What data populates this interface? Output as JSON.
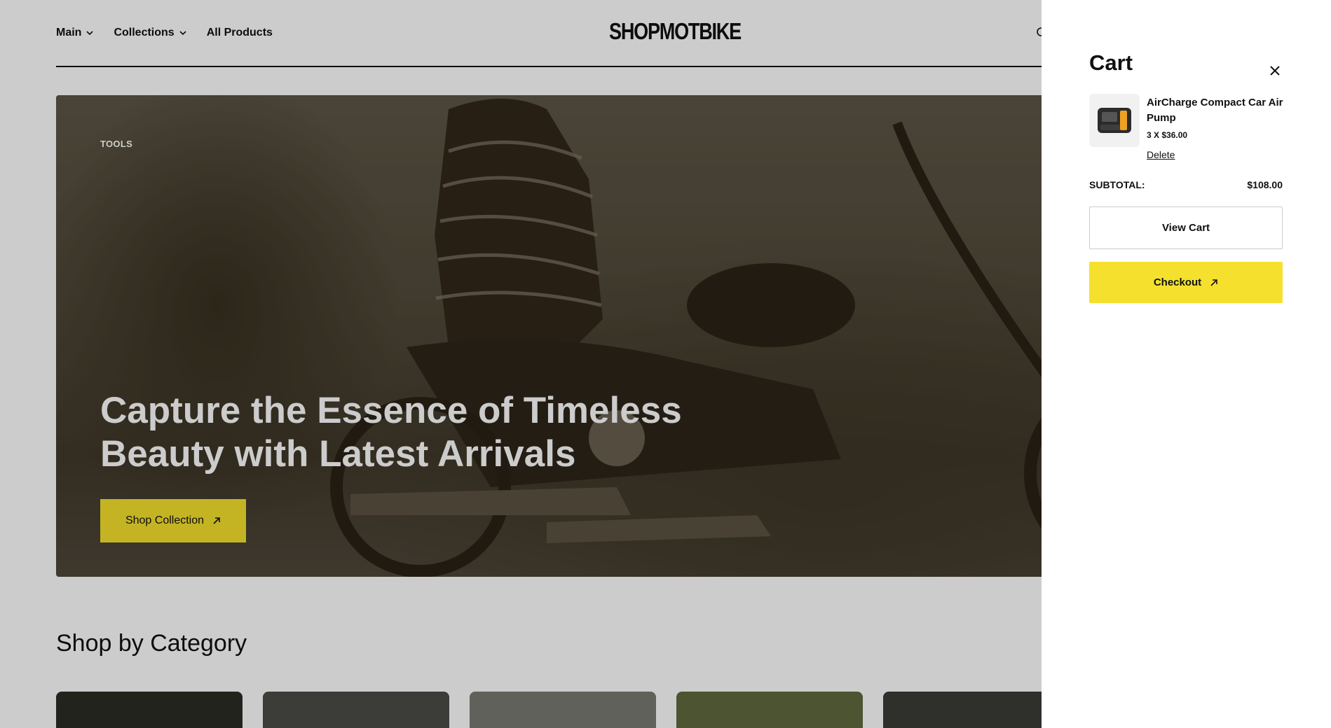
{
  "header": {
    "nav": [
      {
        "label": "Main",
        "has_dropdown": true
      },
      {
        "label": "Collections",
        "has_dropdown": true
      },
      {
        "label": "All Products",
        "has_dropdown": false
      }
    ],
    "logo": "SHOPMOTBIKE"
  },
  "hero": {
    "tag": "TOOLS",
    "title": "Capture the Essence of Timeless Beauty with Latest Arrivals",
    "button_label": "Shop Collection",
    "button_color": "#f5e12d"
  },
  "categories": {
    "title": "Shop by Category",
    "cards": [
      {
        "color": "#2c2c26"
      },
      {
        "color": "#4b4b47"
      },
      {
        "color": "#7a7a72"
      },
      {
        "color": "#5f6a3e"
      },
      {
        "color": "#3b3b38"
      }
    ]
  },
  "cart": {
    "title": "Cart",
    "items": [
      {
        "name": "AirCharge Compact Car Air Pump",
        "quantity_price": "3 X $36.00",
        "delete_label": "Delete"
      }
    ],
    "subtotal_label": "SUBTOTAL:",
    "subtotal_value": "$108.00",
    "view_cart_label": "View Cart",
    "checkout_label": "Checkout",
    "checkout_color": "#f5e12d"
  }
}
